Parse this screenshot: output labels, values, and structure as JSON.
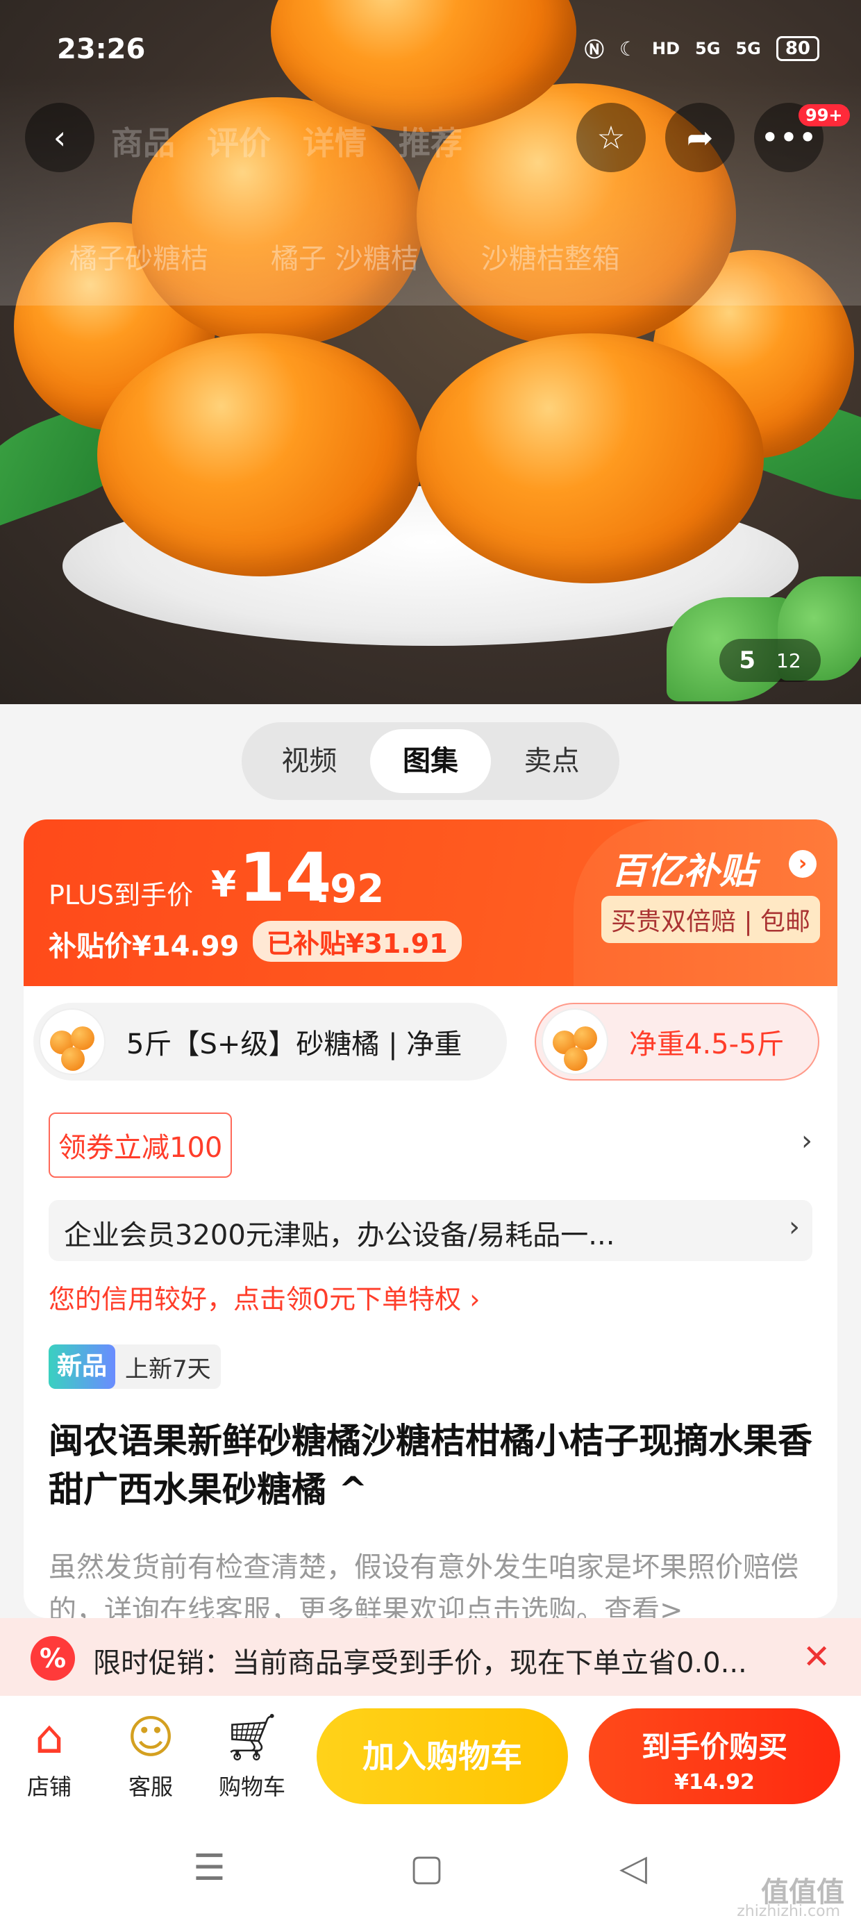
{
  "status_bar": {
    "time": "23:26",
    "network_label": "5G",
    "network_label_2": "5G",
    "hd_label": "HD",
    "battery": "80",
    "icons": [
      "nfc-icon",
      "moon-icon"
    ]
  },
  "header": {
    "ghost_tabs": [
      "商品",
      "评价",
      "详情",
      "推荐"
    ],
    "search_suggestions": [
      "橘子砂糖桔",
      "橘子 沙糖桔",
      "沙糖桔整箱"
    ],
    "message_badge": "99+"
  },
  "gallery": {
    "current": "5",
    "total": "12"
  },
  "media_tabs": [
    {
      "label": "视频",
      "active": false
    },
    {
      "label": "图集",
      "active": true
    },
    {
      "label": "卖点",
      "active": false
    }
  ],
  "price": {
    "plus_label": "PLUS到手价",
    "plus_yen": "¥",
    "plus_int": "14",
    "plus_dec": ".92",
    "subsidy_price": "补贴价¥14.99",
    "subsidy_amount": "已补贴¥31.91",
    "brand": "百亿补贴",
    "brand_tag": "买贵双倍赔 | 包邮",
    "band_color": "#ff4a1a"
  },
  "sku": {
    "options": [
      {
        "label": "5斤【S+级】砂糖橘 | 净重",
        "selected": false
      },
      {
        "label": "净重4.5-5斤",
        "selected": true
      }
    ]
  },
  "coupon": {
    "label": "领券立减100"
  },
  "enterprise": {
    "text": "企业会员3200元津贴，办公设备/易耗品一..."
  },
  "credit": {
    "text": "您的信用较好，点击领0元下单特权 ›"
  },
  "new_tag": {
    "badge": "新品",
    "days": "上新7天"
  },
  "product": {
    "title": "闽农语果新鲜砂糖橘沙糖桔柑橘小桔子现摘水果香甜广西水果砂糖橘 ^",
    "description": "虽然发货前有检查清楚，假设有意外发生咱家是坏果照价赔偿的，详询在线客服，更多鲜果欢迎点击选购。查看>"
  },
  "promo": {
    "text": "限时促销：当前商品享受到手价，现在下单立省0.0..."
  },
  "actions": {
    "shop": "店铺",
    "service": "客服",
    "cart": "购物车",
    "add_to_cart": "加入购物车",
    "buy_label": "到手价购买",
    "buy_price": "¥14.92"
  },
  "watermark": {
    "brand": "值值值",
    "domain": "zhizhizhi.com"
  }
}
